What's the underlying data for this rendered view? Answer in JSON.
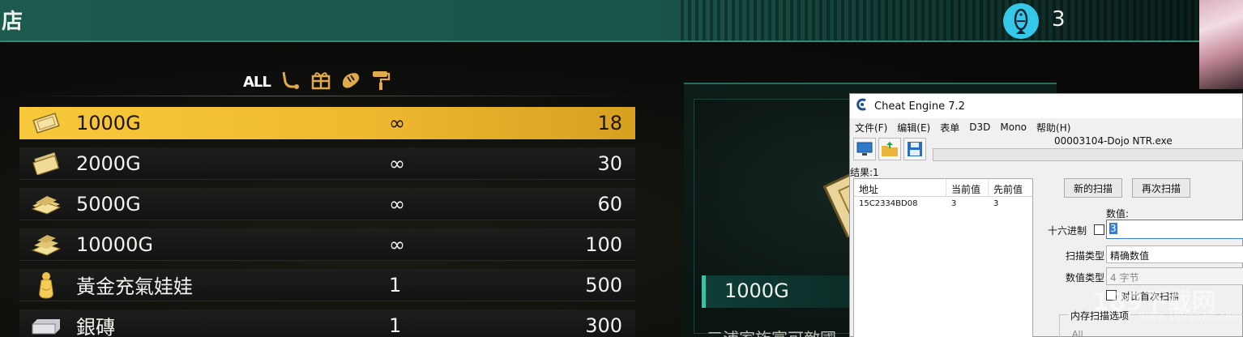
{
  "game": {
    "title": "店",
    "currency_count": "3",
    "categories": {
      "all_label": "ALL"
    },
    "items": [
      {
        "name": "1000G",
        "qty": "∞",
        "price": "18",
        "icon": "gold-bill-icon",
        "selected": true
      },
      {
        "name": "2000G",
        "qty": "∞",
        "price": "30",
        "icon": "gold-bill-icon",
        "selected": false
      },
      {
        "name": "5000G",
        "qty": "∞",
        "price": "60",
        "icon": "gold-stack-icon",
        "selected": false
      },
      {
        "name": "10000G",
        "qty": "∞",
        "price": "100",
        "icon": "gold-pile-icon",
        "selected": false
      },
      {
        "name": "黃金充氣娃娃",
        "qty": "1",
        "price": "500",
        "icon": "golden-doll-icon",
        "selected": false
      },
      {
        "name": "銀磚",
        "qty": "1",
        "price": "300",
        "icon": "silver-brick-icon",
        "selected": false
      }
    ],
    "detail": {
      "name": "1000G",
      "description": "三浦家族富可敵國"
    },
    "colors": {
      "accent": "#1c5a4e",
      "selected": "#f0b930",
      "currency_badge": "#35c8e8"
    }
  },
  "cheat_engine": {
    "title": "Cheat Engine 7.2",
    "menus": [
      "文件(F)",
      "编辑(E)",
      "表单",
      "D3D",
      "Mono",
      "帮助(H)"
    ],
    "process": "00003104-Dojo NTR.exe",
    "results": "结果:1",
    "columns": [
      "地址",
      "当前值",
      "先前值"
    ],
    "rows": [
      {
        "address": "15C2334BD08",
        "current": "3",
        "previous": "3"
      }
    ],
    "buttons": {
      "new_scan": "新的扫描",
      "next_scan": "再次扫描"
    },
    "value_label": "数值:",
    "hex_label": "十六进制",
    "value": "3",
    "scan_type_label": "扫描类型",
    "scan_type": "精确数值",
    "value_type_label": "数值类型",
    "value_type": "4 字节",
    "compare_first_label": "对比首次扫描",
    "memory_options_label": "内存扫描选项",
    "memory_region": "All"
  },
  "watermark": {
    "text": "189下载网",
    "sub": "www.189down.com"
  }
}
